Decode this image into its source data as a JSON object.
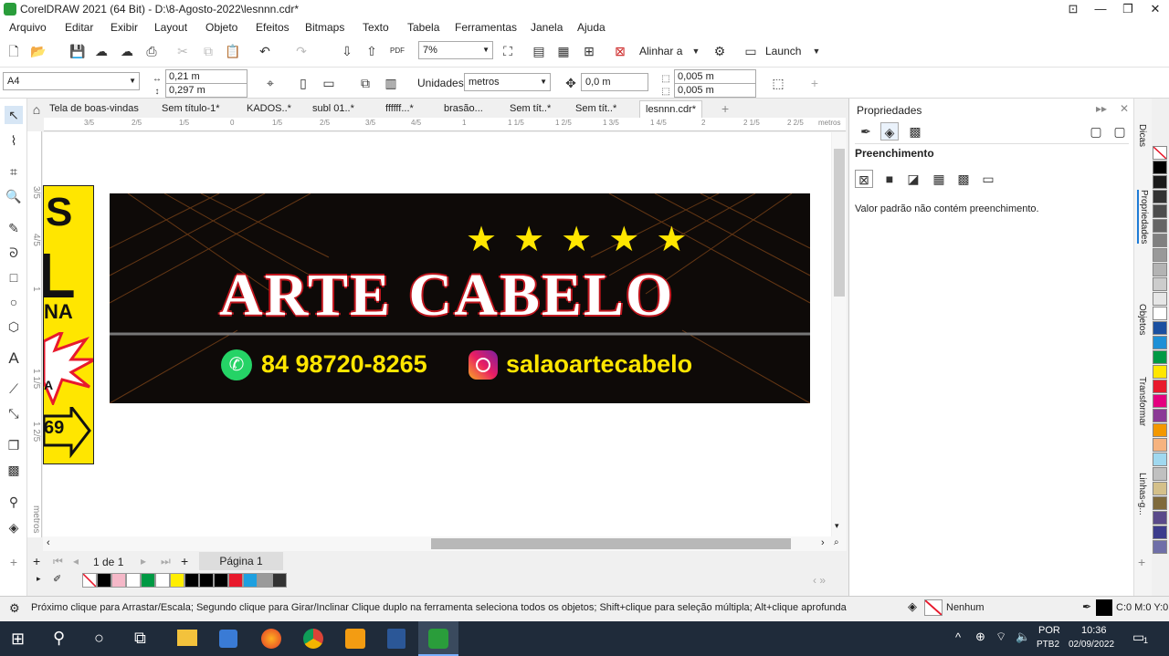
{
  "window": {
    "title": "CorelDRAW 2021 (64 Bit) - D:\\8-Agosto-2022\\lesnnn.cdr*"
  },
  "menu": [
    "Arquivo",
    "Editar",
    "Exibir",
    "Layout",
    "Objeto",
    "Efeitos",
    "Bitmaps",
    "Texto",
    "Tabela",
    "Ferramentas",
    "Janela",
    "Ajuda"
  ],
  "toolbar": {
    "zoom": "7%",
    "align_label": "Alinhar a",
    "launch_label": "Launch",
    "pdf_label": "PDF"
  },
  "propbar": {
    "page_size": "A4",
    "width": "0,21 m",
    "height": "0,297 m",
    "units_label": "Unidades:",
    "units_value": "metros",
    "nudge": "0,0 m",
    "dup_x": "0,005 m",
    "dup_y": "0,005 m"
  },
  "tabs": [
    "Tela de boas-vindas",
    "Sem título-1*",
    "KADOS..*",
    "subl 01..*",
    "ffffff...*",
    "brasão...",
    "Sem tít..*",
    "Sem tít..*",
    "lesnnn.cdr*"
  ],
  "ruler": {
    "h_labels": [
      "3/5",
      "2/5",
      "1/5",
      "0",
      "1/5",
      "2/5",
      "3/5",
      "4/5",
      "1",
      "1 1/5",
      "1 2/5",
      "1 3/5",
      "1 4/5",
      "2",
      "2 1/5",
      "2 2/5"
    ],
    "unit": "metros",
    "v_labels": [
      "3/5",
      "4/5",
      "1",
      "1 1/5",
      "1 2/5",
      "metros"
    ]
  },
  "design": {
    "title": "ARTE CABELO",
    "phone": "84 98720-8265",
    "instagram": "salaoartecabelo",
    "star_count": 5,
    "partial_text": [
      "S",
      "L",
      "NA",
      "A",
      "69"
    ]
  },
  "pagebar": {
    "page_count": "1 de 1",
    "page_tab": "Página 1"
  },
  "panel": {
    "title": "Propriedades",
    "section": "Preenchimento",
    "message": "Valor padrão não contém preenchimento."
  },
  "sidetabs": [
    "Dicas",
    "Propriedades",
    "Objetos",
    "Transformar",
    "Linhas-g..."
  ],
  "palette_bottom": [
    "#ffffff",
    "#000000",
    "#f5b8c8",
    "#ffffff",
    "#009944",
    "#ffffff",
    "#ffee00",
    "#000000",
    "#000000",
    "#000000",
    "#e8192c",
    "#1ea0e0",
    "#9a9a9a",
    "#333333"
  ],
  "palette_right": [
    "#ffffff",
    "#000000",
    "#1a1a1a",
    "#333333",
    "#4d4d4d",
    "#666666",
    "#808080",
    "#999999",
    "#b3b3b3",
    "#cccccc",
    "#e6e6e6",
    "#ffffff",
    "#1a4fa0",
    "#1e90d6",
    "#009944",
    "#ffe600",
    "#e8192c",
    "#e4007f",
    "#8b3a96",
    "#f39800",
    "#f6b37f",
    "#a0d8ef",
    "#c0c0c0",
    "#d4c08a",
    "#7f6a3c",
    "#5a4a8a",
    "#3c3c8c",
    "#6f6fa8"
  ],
  "status": {
    "hint": "Próximo clique para Arrastar/Escala; Segundo clique para Girar/Inclinar Clique duplo na ferramenta seleciona todos os objetos; Shift+clique para seleção múltipla; Alt+clique aprofunda",
    "fill": "Nenhum",
    "color": "C:0 M:0 Y:0"
  },
  "taskbar": {
    "lang1": "POR",
    "lang2": "PTB2",
    "time": "10:36",
    "date": "02/09/2022",
    "notif": "1"
  }
}
